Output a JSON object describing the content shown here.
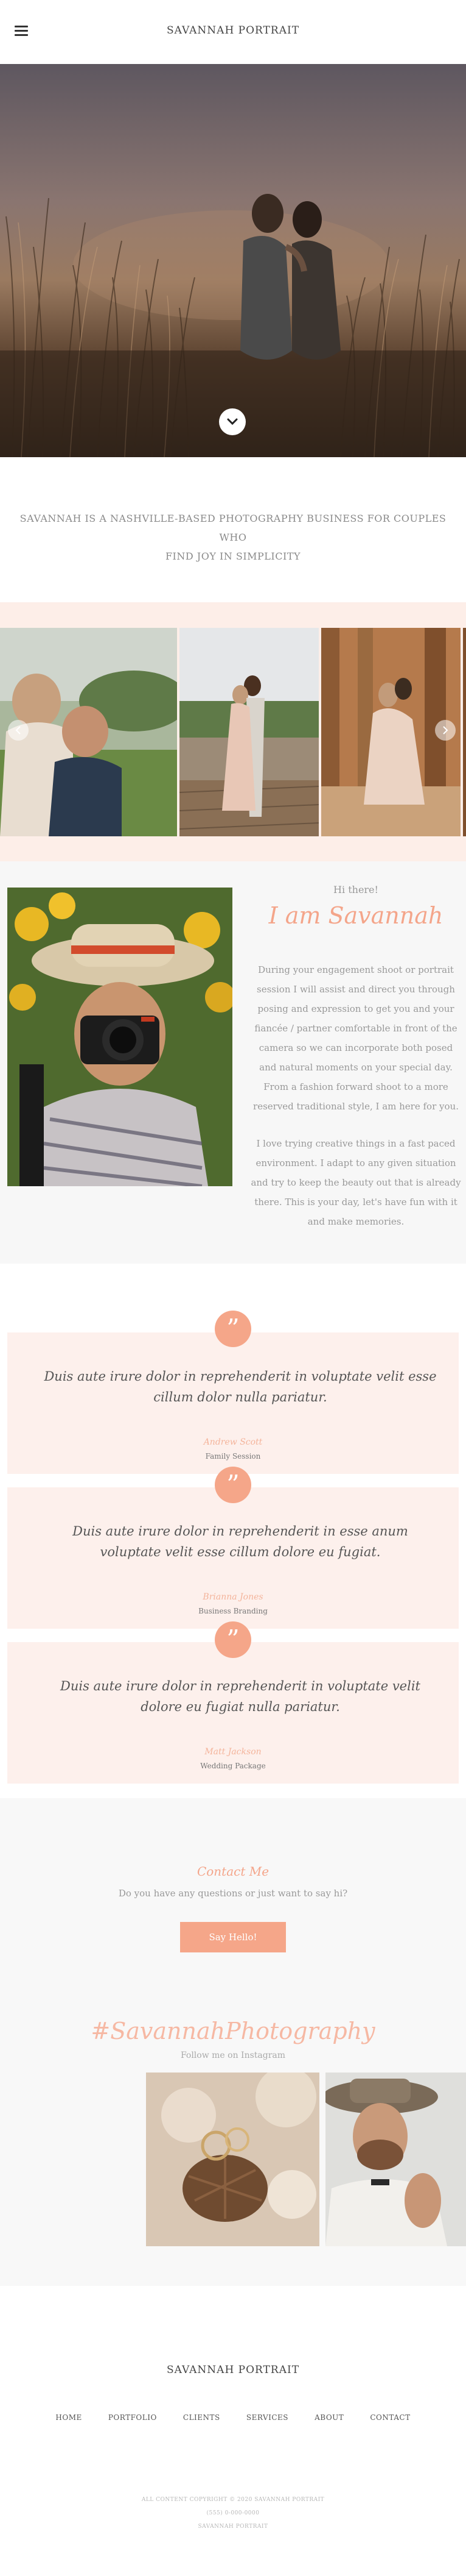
{
  "header": {
    "title": "SAVANNAH PORTRAIT"
  },
  "intro": {
    "line1": "SAVANNAH IS A NASHVILLE-BASED PHOTOGRAPHY BUSINESS FOR COUPLES WHO",
    "line2": "FIND JOY IN SIMPLICITY"
  },
  "about": {
    "greeting": "Hi there!",
    "name": "I am Savannah",
    "paragraph1": "During your engagement shoot or portrait session I will assist and direct you through posing and expression to get you and your fiancée / partner comfortable in front of the camera so we can incorporate both posed and natural moments on your special day. From a fashion forward shoot to a more reserved traditional style, I am here for you.",
    "paragraph2": "I love trying creative things in a fast paced environment. I adapt to any given situation and try to keep the beauty out that is already there. This is your day, let's have fun with it and make memories."
  },
  "testimonials": [
    {
      "quote": "Duis aute irure dolor in reprehenderit in voluptate velit esse cillum dolor nulla pariatur.",
      "name": "Andrew Scott",
      "event": "Family Session"
    },
    {
      "quote": "Duis aute irure dolor in reprehenderit in esse anum voluptate velit esse cillum dolore eu fugiat.",
      "name": "Brianna Jones",
      "event": "Business Branding"
    },
    {
      "quote": "Duis aute irure dolor in reprehenderit in voluptate velit dolore eu fugiat nulla pariatur.",
      "name": "Matt Jackson",
      "event": "Wedding Package"
    }
  ],
  "contact": {
    "title": "Contact Me",
    "subtitle": "Do you have any questions or just want to say hi?",
    "button": "Say Hello!"
  },
  "instagram": {
    "hashtag": "#SavannahPhotography",
    "follow": "Follow me on Instagram"
  },
  "footer": {
    "title": "SAVANNAH PORTRAIT",
    "nav": [
      "HOME",
      "PORTFOLIO",
      "CLIENTS",
      "SERVICES",
      "ABOUT",
      "CONTACT"
    ],
    "copyright": "ALL CONTENT COPYRIGHT © 2020 SAVANNAH PORTRAIT",
    "phone": "(555) 0-000-0000",
    "name": "SAVANNAH PORTRAIT"
  },
  "colors": {
    "accent": "#f5a689",
    "band": "#fdeee8",
    "card": "#fdf0ec"
  },
  "icons": {
    "menu": "hamburger-icon",
    "down": "chevron-down-icon",
    "prev": "chevron-left-icon",
    "next": "chevron-right-icon",
    "quote": "quote-icon"
  }
}
